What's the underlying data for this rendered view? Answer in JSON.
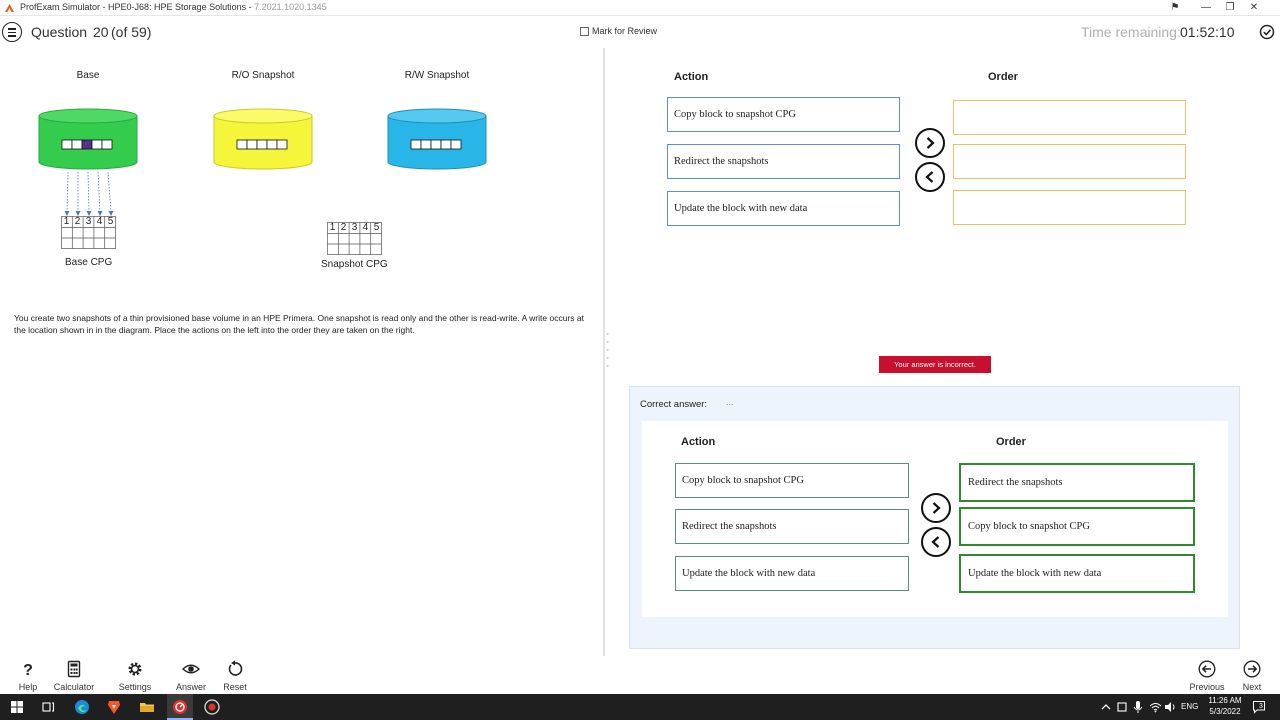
{
  "titlebar": {
    "title": "ProfExam Simulator - HPE0-J68: HPE Storage Solutions - ",
    "version": "7.2021.1020.1345",
    "controls": [
      "⚑",
      "—",
      "❐",
      "✕"
    ]
  },
  "header": {
    "question_label": "Question",
    "question_number": "20",
    "question_of": "(of 59)",
    "mark_for_review": "Mark for Review",
    "time_label": "Time remaining:",
    "time_value": "01:52:10"
  },
  "diagram": {
    "volumes": [
      {
        "label": "Base",
        "color": "#33cc4d",
        "top_color": "#4ed864"
      },
      {
        "label": "R/O Snapshot",
        "color": "#f5f53a",
        "top_color": "#fbfb6a"
      },
      {
        "label": "R/W Snapshot",
        "color": "#28b6e8",
        "top_color": "#55c9f0"
      }
    ],
    "cpgs": [
      {
        "label": "Base CPG",
        "cells": [
          "1",
          "2",
          "3",
          "4",
          "5"
        ]
      },
      {
        "label": "Snapshot CPG",
        "cells": [
          "1",
          "2",
          "3",
          "4",
          "5"
        ]
      }
    ],
    "highlight_color": "#5b2d8e"
  },
  "question_text": "You create two snapshots of a thin provisioned base volume in an HPE Primera. One snapshot is read only and the other is read-write. A write occurs at the location shown in in the diagram. Place the actions on the left into the order they are taken on the right.",
  "answer_area": {
    "action_heading": "Action",
    "order_heading": "Order",
    "actions": [
      "Copy block to snapshot CPG",
      "Redirect the snapshots",
      "Update the block with new data"
    ],
    "order": [
      "",
      "",
      ""
    ]
  },
  "result_badge": "Your answer is incorrect.",
  "correct_answer": {
    "label": "Correct answer:",
    "dots": "...",
    "action_heading": "Action",
    "order_heading": "Order",
    "actions": [
      "Copy block to snapshot CPG",
      "Redirect the snapshots",
      "Update the block with new data"
    ],
    "order": [
      "Redirect the snapshots",
      "Copy block to snapshot CPG",
      "Update the block with new data"
    ]
  },
  "toolbar": {
    "help": "Help",
    "calculator": "Calculator",
    "settings": "Settings",
    "answer": "Answer",
    "reset": "Reset",
    "previous": "Previous",
    "next": "Next"
  },
  "taskbar": {
    "language": "ENG",
    "time": "11:26 AM",
    "date": "5/3/2022",
    "notifications": "3"
  }
}
